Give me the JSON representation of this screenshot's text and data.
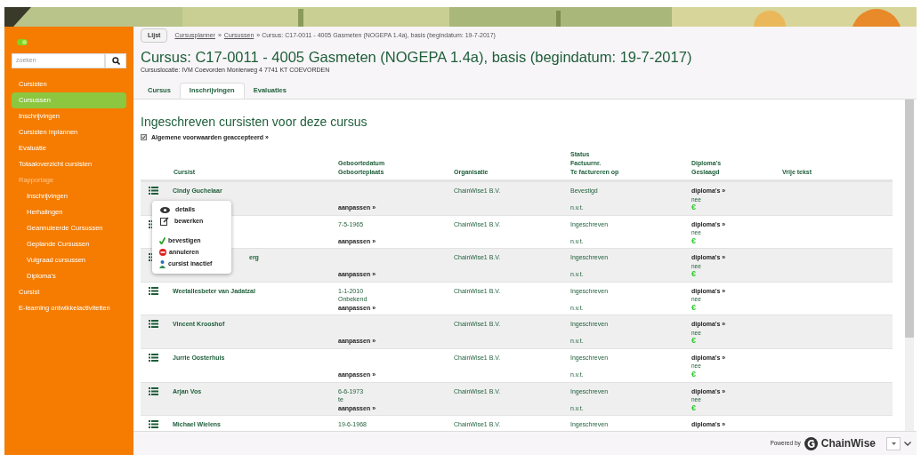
{
  "sidebar": {
    "toggle": {
      "on": true
    },
    "search": {
      "placeholder": "zoeken"
    },
    "items": [
      {
        "label": "Cursisten",
        "selected": false,
        "disabled": false
      },
      {
        "label": "Cursussen",
        "selected": true,
        "disabled": false
      },
      {
        "label": "Inschrijvingen",
        "selected": false,
        "disabled": false
      },
      {
        "label": "Cursisten inplannen",
        "selected": false,
        "disabled": false
      },
      {
        "label": "Evaluatie",
        "selected": false,
        "disabled": false
      },
      {
        "label": "Totaaloverzicht cursisten",
        "selected": false,
        "disabled": false
      },
      {
        "label": "Rapportage",
        "selected": false,
        "disabled": true,
        "children": [
          {
            "label": "Inschrijvingen",
            "selected": false,
            "disabled": false
          },
          {
            "label": "Herhalingen",
            "selected": false,
            "disabled": false
          },
          {
            "label": "Geannuleerde Cursussen",
            "selected": false,
            "disabled": false
          },
          {
            "label": "Geplande Cursussen",
            "selected": false,
            "disabled": false
          },
          {
            "label": "Vulgraad cursussen",
            "selected": false,
            "disabled": false
          },
          {
            "label": "Diploma's",
            "selected": false,
            "disabled": false
          }
        ]
      },
      {
        "label": "Cursist",
        "selected": false,
        "disabled": false
      },
      {
        "label": "E-learning ontwikkelactiviteiten",
        "selected": false,
        "disabled": false
      }
    ]
  },
  "toolbar": {
    "button": "Lijst",
    "breadcrumb": [
      {
        "label": "Cursusplanner",
        "link": true
      },
      {
        "label": "»",
        "link": false
      },
      {
        "label": "Cursussen",
        "link": true
      },
      {
        "label": "» Cursus: C17-0011 - 4005 Gasmeten (NOGEPA 1.4a), basis (begindatum: 19-7-2017)",
        "link": false
      }
    ]
  },
  "title": "Cursus: C17-0011 - 4005 Gasmeten (NOGEPA 1.4a), basis (begindatum: 19-7-2017)",
  "location": "Cursuslocatie: IVM Coevorden Monierweg 4 7741 KT COEVORDEN",
  "tabs": [
    {
      "label": "Cursus",
      "selected": false
    },
    {
      "label": "Inschrijvingen",
      "selected": true
    },
    {
      "label": "Evaluaties",
      "selected": false
    }
  ],
  "heading": "Ingeschreven cursisten voor deze cursus",
  "terms": {
    "checked": true,
    "label": "Algemene voorwaarden geaccepteerd »"
  },
  "table": {
    "columns": [
      [
        "Cursist"
      ],
      [
        "Geboortedatum",
        "Geboorteplaats"
      ],
      [
        "Organisatie"
      ],
      [
        "Status",
        "Factuurnr.",
        "Te factureren op"
      ],
      [
        "Diploma's",
        "Geslaagd"
      ],
      [
        "Vrije tekst"
      ]
    ],
    "rows": [
      {
        "kind": "full",
        "name": "Cindy Guchelaar",
        "adjust": "aanpassen »",
        "org": "ChainWise1 B.V.",
        "status": "Bevestigd",
        "invoice_to": "n.v.t.",
        "diplomas": "diploma's »",
        "passed": "nee",
        "fee": "€"
      },
      {
        "kind": "covered",
        "birth_date": "7-5-1965",
        "adjust": "aanpassen »",
        "org": "ChainWise1 B.V.",
        "status": "Ingeschreven",
        "invoice_to": "n.v.t.",
        "diplomas": "diploma's »",
        "passed": "nee",
        "fee": "€"
      },
      {
        "kind": "covered",
        "name": "erg",
        "adjust": "aanpassen »",
        "org": "ChainWise1 B.V.",
        "status": "Ingeschreven",
        "invoice_to": "n.v.t.",
        "diplomas": "diploma's »",
        "passed": "nee",
        "fee": "€"
      },
      {
        "kind": "full",
        "name": "Weetallesbeter van Jadatzal",
        "birth_date": "1-1-2010",
        "birth_place": "Onbekend",
        "adjust": "aanpassen »",
        "org": "ChainWise1 B.V.",
        "status": "Ingeschreven",
        "invoice_to": "n.v.t.",
        "diplomas": "diploma's »",
        "passed": "nee",
        "fee": "€"
      },
      {
        "kind": "full",
        "name": "Vincent Krooshof",
        "adjust": "aanpassen »",
        "org": "ChainWise1 B.V.",
        "status": "Ingeschreven",
        "invoice_to": "n.v.t.",
        "diplomas": "diploma's »",
        "passed": "nee",
        "fee": "€"
      },
      {
        "kind": "full",
        "name": "Jurrie Oosterhuis",
        "adjust": "aanpassen »",
        "org": "ChainWise1 B.V.",
        "status": "Ingeschreven",
        "invoice_to": "n.v.t.",
        "diplomas": "diploma's »",
        "passed": "nee",
        "fee": "€"
      },
      {
        "kind": "full",
        "name": "Arjan Vos",
        "birth_date": "6-6-1973",
        "birth_place": "te",
        "adjust": "aanpassen »",
        "org": "ChainWise1 B.V.",
        "status": "Ingeschreven",
        "invoice_to": "n.v.t.",
        "diplomas": "diploma's »",
        "passed": "nee",
        "fee": "€"
      },
      {
        "kind": "full",
        "name": "Michael Wielens",
        "birth_date": "19-6-1968",
        "org": "ChainWise1 B.V.",
        "status": "Ingeschreven",
        "diplomas": "diploma's »"
      }
    ]
  },
  "row_menu": {
    "items": [
      {
        "kind": "eye",
        "label": "details"
      },
      {
        "kind": "edit",
        "label": "bewerken"
      },
      {
        "kind": "check",
        "label": "bevestigen"
      },
      {
        "kind": "stop",
        "label": "annuleren"
      },
      {
        "kind": "person",
        "label": "cursist inactief"
      }
    ]
  },
  "footer": {
    "powered_by": "Powered by",
    "brand": "ChainWise"
  }
}
